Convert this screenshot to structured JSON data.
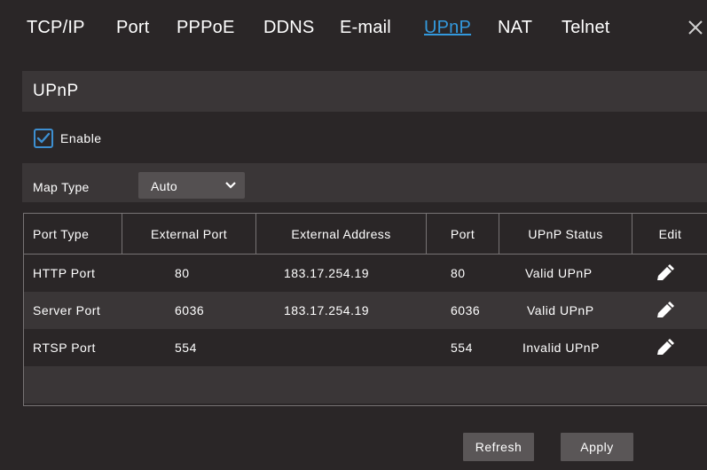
{
  "tabs": [
    {
      "label": "TCP/IP",
      "active": false
    },
    {
      "label": "Port",
      "active": false
    },
    {
      "label": "PPPoE",
      "active": false
    },
    {
      "label": "DDNS",
      "active": false
    },
    {
      "label": "E-mail",
      "active": false
    },
    {
      "label": "UPnP",
      "active": true
    },
    {
      "label": "NAT",
      "active": false
    },
    {
      "label": "Telnet",
      "active": false
    }
  ],
  "section": {
    "title": "UPnP"
  },
  "enable": {
    "label": "Enable",
    "checked": true
  },
  "map_type": {
    "label": "Map Type",
    "value": "Auto"
  },
  "table": {
    "headers": [
      "Port Type",
      "External Port",
      "External Address",
      "Port",
      "UPnP Status",
      "Edit"
    ],
    "rows": [
      {
        "port_type": "HTTP Port",
        "external_port": "80",
        "external_address": "183.17.254.19",
        "port": "80",
        "status": "Valid UPnP"
      },
      {
        "port_type": "Server Port",
        "external_port": "6036",
        "external_address": "183.17.254.19",
        "port": "6036",
        "status": "Valid UPnP"
      },
      {
        "port_type": "RTSP Port",
        "external_port": "554",
        "external_address": "",
        "port": "554",
        "status": "Invalid UPnP"
      }
    ]
  },
  "buttons": {
    "refresh": "Refresh",
    "apply": "Apply"
  },
  "colors": {
    "accent": "#3399dd",
    "background": "#2a2627",
    "panel": "#3a3637",
    "button": "#5a5657"
  }
}
